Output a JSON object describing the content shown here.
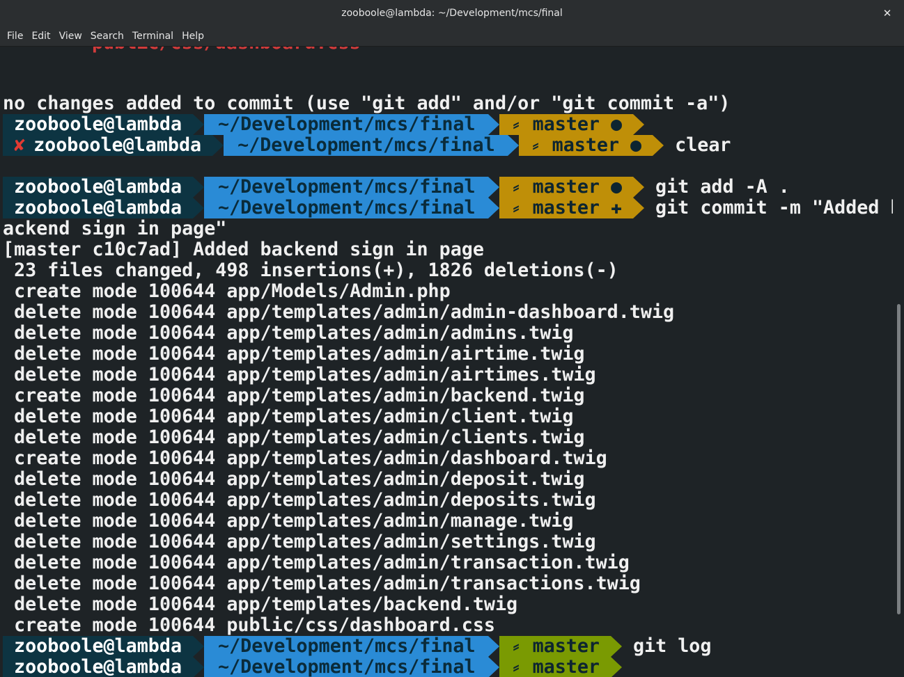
{
  "window": {
    "title": "zooboole@lambda: ~/Development/mcs/final",
    "close_glyph": "✕"
  },
  "menu": [
    "File",
    "Edit",
    "View",
    "Search",
    "Terminal",
    "Help"
  ],
  "prompt": {
    "user": "zooboole@lambda",
    "path": "~/Development/mcs/final",
    "branch": "master",
    "branch_icon": "git-branch-icon",
    "error_mark": "✘"
  },
  "colors": {
    "user_bg": "#0d3442",
    "path_bg": "#2a8bd6",
    "git_dirty_bg": "#bf8f08",
    "git_clean_bg": "#7a9a02",
    "error": "#e23a32",
    "terminal_bg": "#1e2326"
  },
  "terminal": {
    "cut_top": "public/css/dashboard.css",
    "blank": "",
    "status_msg": "no changes added to commit (use \"git add\" and/or \"git commit -a\")",
    "prompts": [
      {
        "status": "●",
        "cmd": ""
      },
      {
        "status": "●",
        "cmd": "clear"
      },
      {
        "status": "●",
        "cmd": "git add -A ."
      },
      {
        "status": "✚",
        "cmd": "git commit -m \"Added b"
      },
      {
        "status": "",
        "cmd": "git log"
      },
      {
        "status": "",
        "cmd": ""
      }
    ],
    "commit_wrap": "ackend sign in page\"",
    "commit_result": "[master c10c7ad] Added backend sign in page",
    "stats": " 23 files changed, 498 insertions(+), 1826 deletions(-)",
    "files": [
      " create mode 100644 app/Models/Admin.php",
      " delete mode 100644 app/templates/admin/admin-dashboard.twig",
      " delete mode 100644 app/templates/admin/admins.twig",
      " delete mode 100644 app/templates/admin/airtime.twig",
      " delete mode 100644 app/templates/admin/airtimes.twig",
      " create mode 100644 app/templates/admin/backend.twig",
      " delete mode 100644 app/templates/admin/client.twig",
      " delete mode 100644 app/templates/admin/clients.twig",
      " create mode 100644 app/templates/admin/dashboard.twig",
      " delete mode 100644 app/templates/admin/deposit.twig",
      " delete mode 100644 app/templates/admin/deposits.twig",
      " delete mode 100644 app/templates/admin/manage.twig",
      " delete mode 100644 app/templates/admin/settings.twig",
      " delete mode 100644 app/templates/admin/transaction.twig",
      " delete mode 100644 app/templates/admin/transactions.twig",
      " delete mode 100644 app/templates/backend.twig",
      " create mode 100644 public/css/dashboard.css"
    ]
  }
}
